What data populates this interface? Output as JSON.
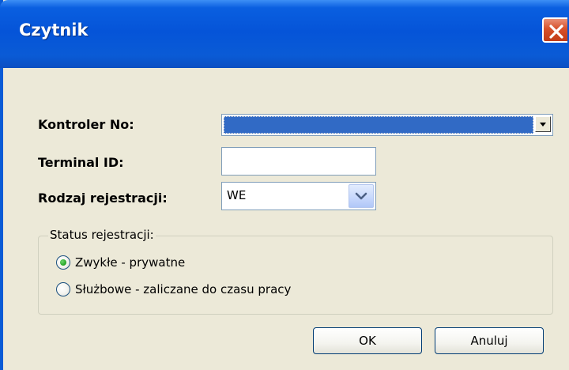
{
  "window": {
    "title": "Czytnik"
  },
  "form": {
    "controller_label": "Kontroler No:",
    "controller_value": "",
    "terminal_label": "Terminal ID:",
    "terminal_value": "",
    "registration_type_label": "Rodzaj rejestracji:",
    "registration_type_value": "WE"
  },
  "status_group": {
    "legend": "Status rejestracji:",
    "options": [
      {
        "label": "Zwykłe - prywatne",
        "selected": true
      },
      {
        "label": "Służbowe - zaliczane do czasu pracy",
        "selected": false
      }
    ]
  },
  "buttons": {
    "ok_label": "OK",
    "cancel_label": "Anuluj"
  },
  "icons": {
    "close": "close-icon",
    "combo_arrow": "chevron-down-icon",
    "radio_selected": "radio-selected-icon",
    "radio_empty": "radio-empty-icon"
  },
  "colors": {
    "titlebar": "#0a5bd6",
    "close_button": "#d6502a",
    "selection": "#316ac5",
    "dialog_bg": "#ece9d8"
  }
}
